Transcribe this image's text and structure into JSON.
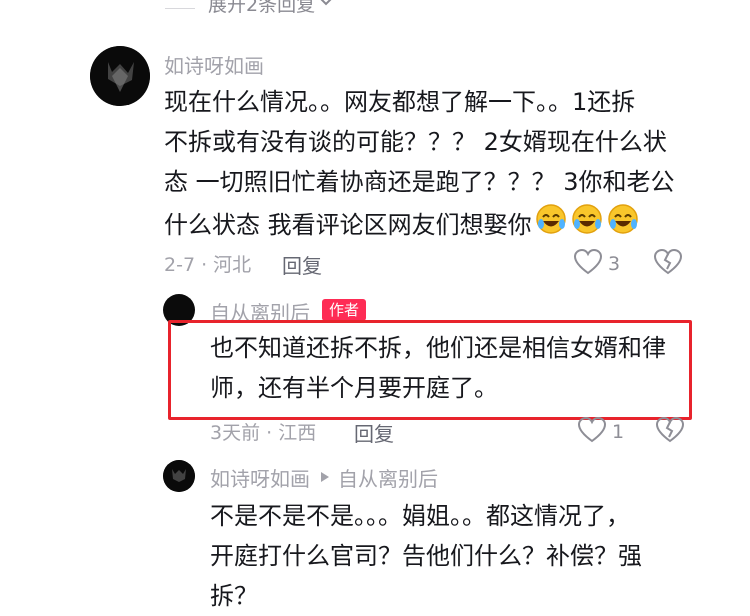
{
  "top": {
    "expand_text": "展开2条回复",
    "chevron": "chevron-down-icon"
  },
  "comment1": {
    "username": "如诗呀如画",
    "lines": [
      "现在什么情况。。网友都想了解一下。。1还拆",
      "不拆或有没有谈的可能？？？ 2女婿现在什么状",
      "态 一切照旧忙着协商还是跑了？？？ 3你和老公",
      "什么状态 我看评论区网友们想娶你"
    ],
    "emojis": [
      "rolling-laugh-emoji",
      "rolling-laugh-emoji",
      "rolling-laugh-emoji"
    ],
    "meta": "2-7 · 河北",
    "reply_label": "回复",
    "like_count": "3"
  },
  "reply1": {
    "username": "自从离别后",
    "badge": "作者",
    "lines": [
      "也不知道还拆不拆，他们还是相信女婿和律",
      "师，还有半个月要开庭了。"
    ],
    "meta": "3天前 · 江西",
    "reply_label": "回复",
    "like_count": "1",
    "highlight_color": "#e8232c"
  },
  "reply2": {
    "username": "如诗呀如画",
    "reply_to": "自从离别后",
    "lines": [
      "不是不是不是。。。娟姐。。都这情况了，",
      "开庭打什么官司？告他们什么？补偿？强",
      "拆？"
    ]
  },
  "colors": {
    "accent": "#fe2c55",
    "text": "#17181d",
    "muted": "#a2a2aa"
  }
}
